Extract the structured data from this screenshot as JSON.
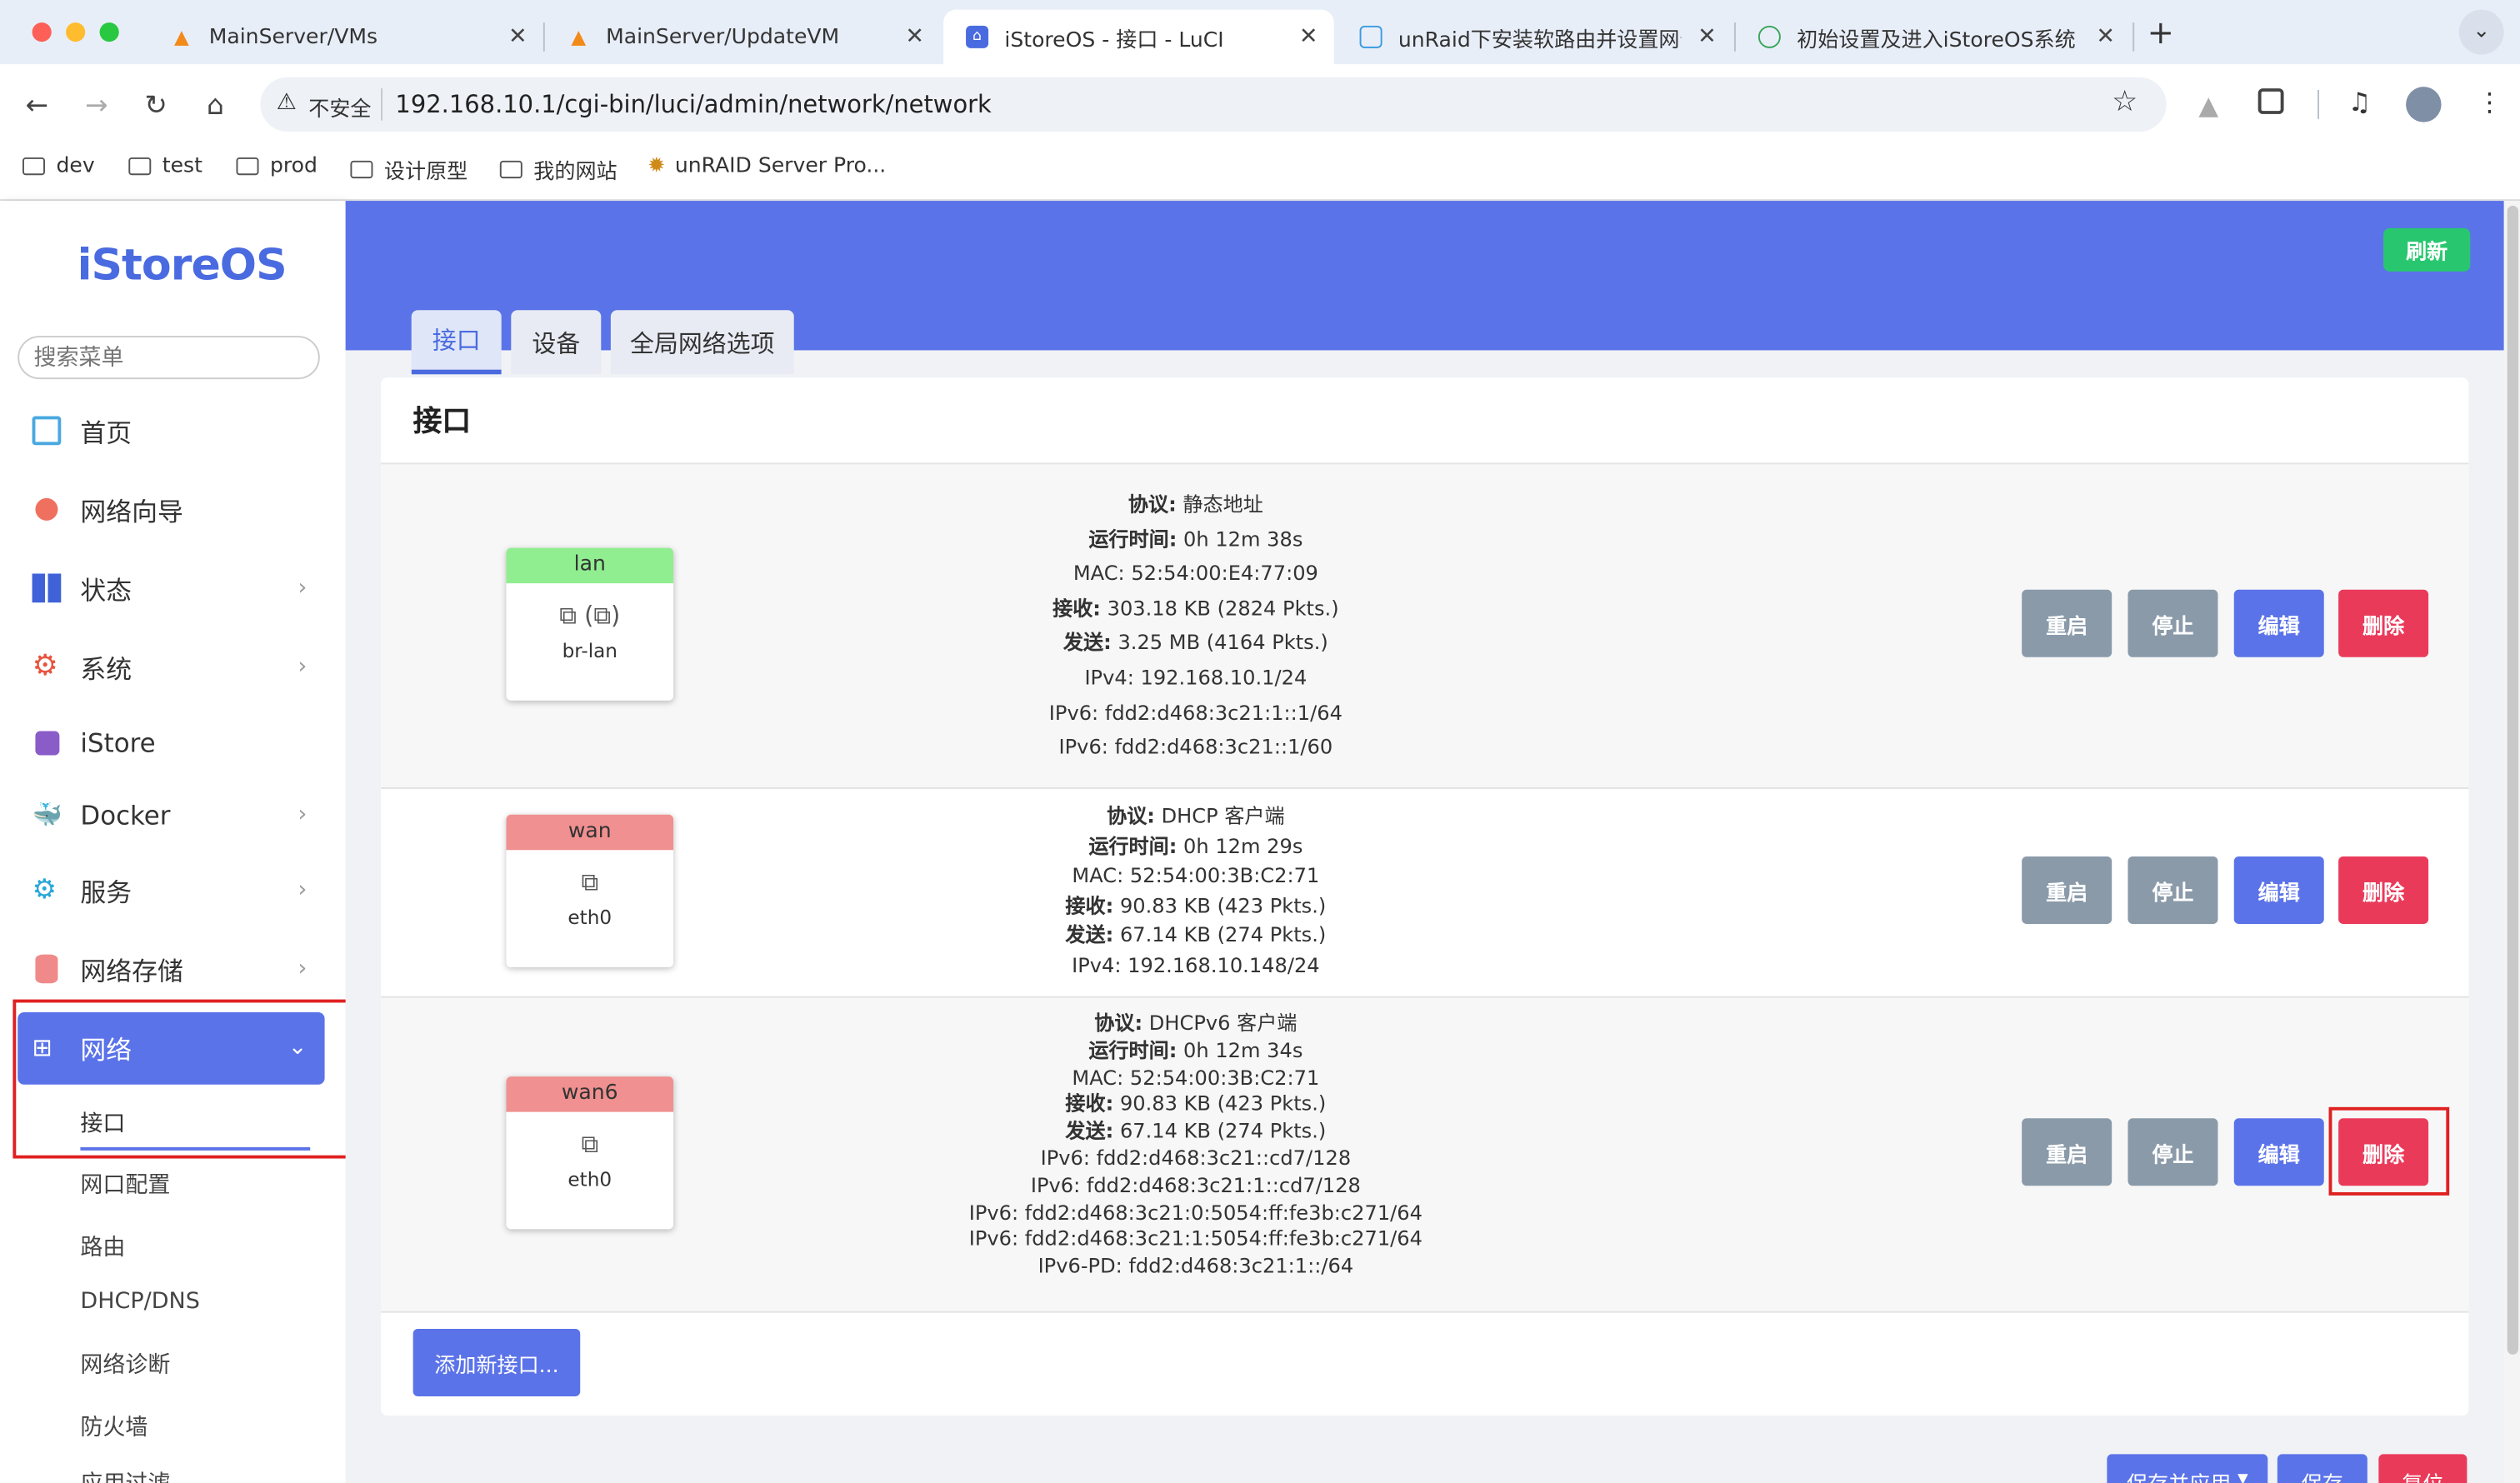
{
  "browser": {
    "tabs": [
      {
        "title": "MainServer/VMs",
        "icon": "unraid-icon"
      },
      {
        "title": "MainServer/UpdateVM",
        "icon": "unraid-icon"
      },
      {
        "title": "iStoreOS - 接口 - LuCI",
        "icon": "istoreos-icon"
      },
      {
        "title": "unRaid下安装软路由并设置网卡",
        "icon": "bilibili-icon"
      },
      {
        "title": "初始设置及进入iStoreOS系统",
        "icon": "site-icon"
      }
    ],
    "security_label": "不安全",
    "url": "192.168.10.1/cgi-bin/luci/admin/network/network",
    "bookmarks": [
      "dev",
      "test",
      "prod",
      "设计原型",
      "我的网站",
      "unRAID Server Pro..."
    ]
  },
  "sidebar": {
    "logo": "iStoreOS",
    "search_placeholder": "搜索菜单",
    "items": [
      {
        "label": "首页",
        "icon": "chart-icon"
      },
      {
        "label": "网络向导",
        "icon": "globe-icon"
      },
      {
        "label": "状态",
        "icon": "dashboard-icon"
      },
      {
        "label": "系统",
        "icon": "gear-icon"
      },
      {
        "label": "iStore",
        "icon": "bag-icon"
      },
      {
        "label": "Docker",
        "icon": "docker-icon"
      },
      {
        "label": "服务",
        "icon": "services-icon"
      },
      {
        "label": "网络存储",
        "icon": "database-icon"
      },
      {
        "label": "网络",
        "icon": "network-icon"
      }
    ],
    "subitems": [
      "接口",
      "网口配置",
      "路由",
      "DHCP/DNS",
      "网络诊断",
      "防火墙",
      "应用过滤"
    ]
  },
  "header": {
    "refresh_label": "刷新",
    "tabs": [
      "接口",
      "设备",
      "全局网络选项"
    ]
  },
  "section_title": "接口",
  "interfaces": [
    {
      "name": "lan",
      "device": "br-lan",
      "head_color": "#90ee90",
      "lines": [
        [
          "协议:",
          " 静态地址"
        ],
        [
          "运行时间:",
          " 0h 12m 38s"
        ],
        [
          "",
          "MAC: 52:54:00:E4:77:09"
        ],
        [
          "接收:",
          " 303.18 KB (2824 Pkts.)"
        ],
        [
          "发送:",
          " 3.25 MB (4164 Pkts.)"
        ],
        [
          "",
          "IPv4: 192.168.10.1/24"
        ],
        [
          "",
          "IPv6: fdd2:d468:3c21:1::1/64"
        ],
        [
          "",
          "IPv6: fdd2:d468:3c21::1/60"
        ]
      ]
    },
    {
      "name": "wan",
      "device": "eth0",
      "head_color": "#f09090",
      "lines": [
        [
          "协议:",
          " DHCP 客户端"
        ],
        [
          "运行时间:",
          " 0h 12m 29s"
        ],
        [
          "",
          "MAC: 52:54:00:3B:C2:71"
        ],
        [
          "接收:",
          " 90.83 KB (423 Pkts.)"
        ],
        [
          "发送:",
          " 67.14 KB (274 Pkts.)"
        ],
        [
          "",
          "IPv4: 192.168.10.148/24"
        ]
      ]
    },
    {
      "name": "wan6",
      "device": "eth0",
      "head_color": "#f09090",
      "lines": [
        [
          "协议:",
          " DHCPv6 客户端"
        ],
        [
          "运行时间:",
          " 0h 12m 34s"
        ],
        [
          "",
          "MAC: 52:54:00:3B:C2:71"
        ],
        [
          "接收:",
          " 90.83 KB (423 Pkts.)"
        ],
        [
          "发送:",
          " 67.14 KB (274 Pkts.)"
        ],
        [
          "",
          "IPv6: fdd2:d468:3c21::cd7/128"
        ],
        [
          "",
          "IPv6: fdd2:d468:3c21:1::cd7/128"
        ],
        [
          "",
          "IPv6: fdd2:d468:3c21:0:5054:ff:fe3b:c271/64"
        ],
        [
          "",
          "IPv6: fdd2:d468:3c21:1:5054:ff:fe3b:c271/64"
        ],
        [
          "",
          "IPv6-PD: fdd2:d468:3c21:1::/64"
        ]
      ]
    }
  ],
  "row_actions": {
    "restart": "重启",
    "stop": "停止",
    "edit": "编辑",
    "delete": "删除"
  },
  "add_interface_label": "添加新接口...",
  "footer": {
    "save_apply": "保存并应用",
    "save": "保存",
    "reset": "复位"
  },
  "colors": {
    "accent": "#5b73e8",
    "gray_btn": "#8a9aa9",
    "delete": "#ea3a5a",
    "refresh": "#28c76f",
    "highlight": "#e02020"
  }
}
